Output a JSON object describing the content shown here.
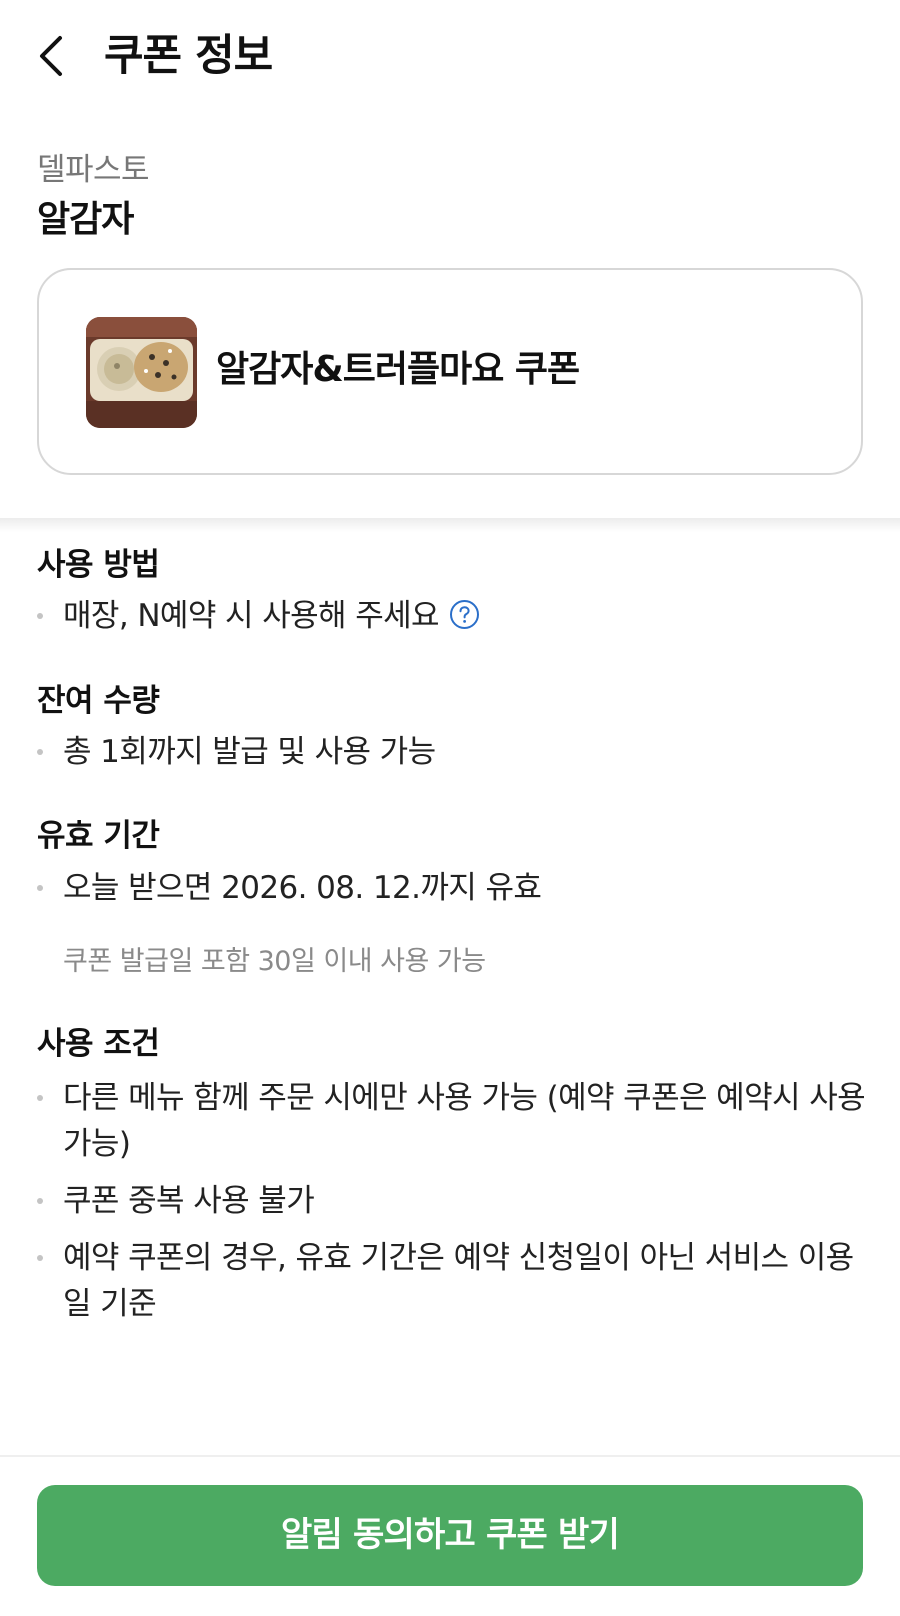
{
  "header": {
    "title": "쿠폰 정보",
    "back_icon": "chevron-left-icon"
  },
  "store": {
    "name": "델파스토",
    "branch": "알감자"
  },
  "coupon": {
    "title": "알감자&트러플마요 쿠폰",
    "image_icon": "food-photo"
  },
  "sections": {
    "usage": {
      "title": "사용 방법",
      "items": [
        "매장, N예약 시 사용해 주세요"
      ],
      "help_icon": "question-circle-icon"
    },
    "remaining": {
      "title": "잔여 수량",
      "items": [
        "총 1회까지 발급 및 사용 가능"
      ]
    },
    "validity": {
      "title": "유효 기간",
      "items": [
        "오늘 받으면 2026. 08. 12.까지 유효"
      ],
      "note": "쿠폰 발급일 포함 30일 이내 사용 가능"
    },
    "conditions": {
      "title": "사용 조건",
      "items": [
        "다른 메뉴 함께 주문 시에만 사용 가능 (예약 쿠폰은 예약시 사용 가능)",
        "쿠폰 중복 사용 불가",
        "예약 쿠폰의 경우, 유효 기간은 예약 신청일이 아닌 서비스 이용일 기준"
      ]
    }
  },
  "cta": {
    "label": "알림 동의하고 쿠폰 받기"
  },
  "colors": {
    "accent": "#4caa62",
    "help_icon": "#2b6fc9",
    "muted_text": "#777777"
  }
}
